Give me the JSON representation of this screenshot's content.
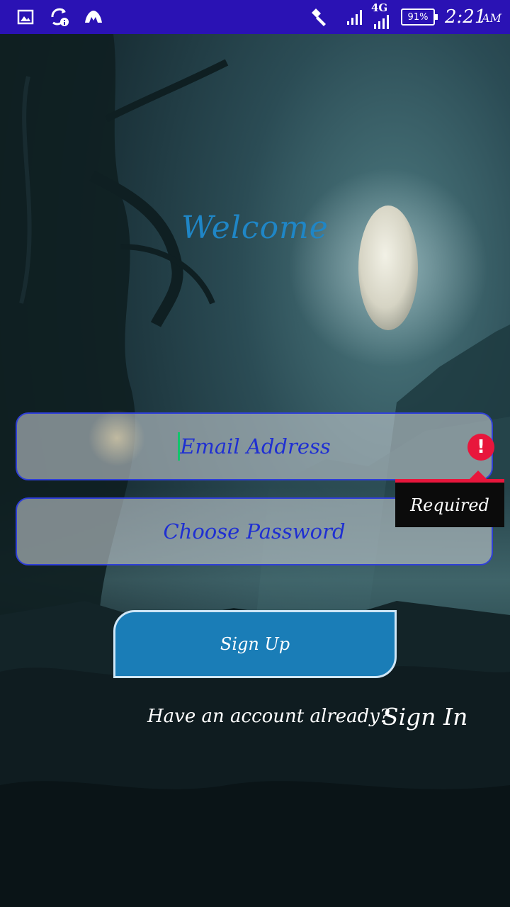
{
  "status_bar": {
    "network": "4G",
    "battery": "91%",
    "time": "2:21",
    "ampm": "AM",
    "color": "#2a12b4"
  },
  "welcome": {
    "title": "Welcome",
    "color": "#1f86c6"
  },
  "form": {
    "email": {
      "placeholder": "Email Address",
      "value": ""
    },
    "password": {
      "placeholder": "Choose Password",
      "value": ""
    },
    "email_error": {
      "icon": "error-icon",
      "message": "Required",
      "color": "#e8163c"
    },
    "signup_label": "Sign Up",
    "signup_color": "#1a7db7"
  },
  "footer": {
    "prompt": "Have an account already?",
    "signin_label": "Sign In"
  }
}
